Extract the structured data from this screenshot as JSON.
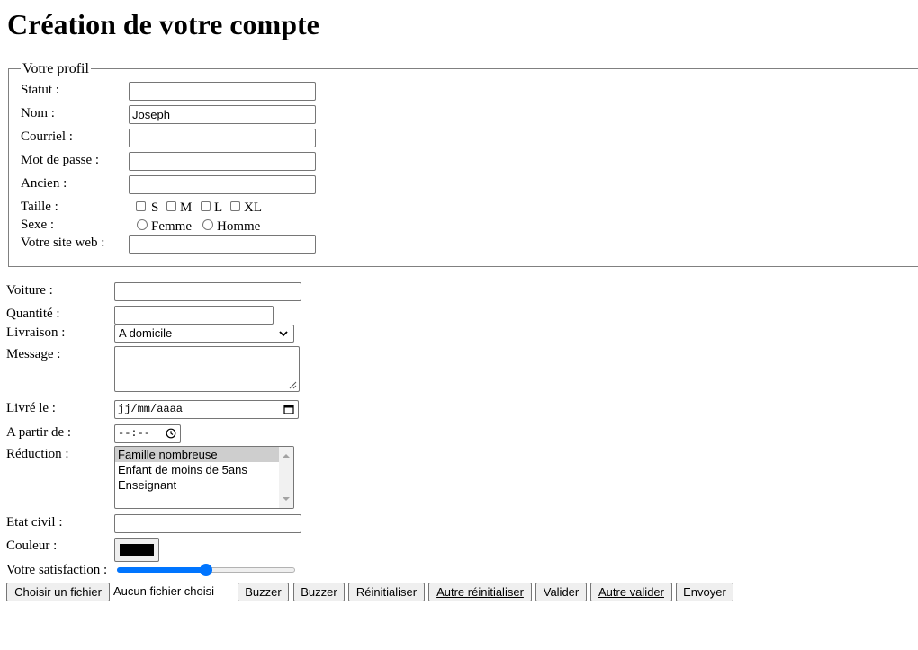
{
  "page_title": "Création de votre compte",
  "fieldset": {
    "legend": "Votre profil",
    "statut": {
      "label": "Statut :",
      "value": ""
    },
    "nom": {
      "label": "Nom :",
      "value": "Joseph"
    },
    "courriel": {
      "label": "Courriel :",
      "value": ""
    },
    "mot_de_passe": {
      "label": "Mot de passe :",
      "value": ""
    },
    "ancien": {
      "label": "Ancien :",
      "value": ""
    },
    "taille": {
      "label": "Taille :",
      "options": [
        "S",
        "M",
        "L",
        "XL"
      ]
    },
    "sexe": {
      "label": "Sexe :",
      "options": [
        "Femme",
        "Homme"
      ]
    },
    "site_web": {
      "label": "Votre site web :",
      "value": ""
    }
  },
  "voiture": {
    "label": "Voiture :",
    "value": ""
  },
  "quantite": {
    "label": "Quantité :",
    "value": ""
  },
  "livraison": {
    "label": "Livraison :",
    "selected": "A domicile"
  },
  "message": {
    "label": "Message :",
    "value": ""
  },
  "livre_le": {
    "label": "Livré le :",
    "placeholder": "jj/mm/aaaa"
  },
  "a_partir_de": {
    "label": "A partir de :",
    "placeholder": "--:--"
  },
  "reduction": {
    "label": "Réduction :",
    "options": [
      "Famille nombreuse",
      "Enfant de moins de 5ans",
      "Enseignant"
    ],
    "selected": "Famille nombreuse"
  },
  "etat_civil": {
    "label": "Etat civil :",
    "value": ""
  },
  "couleur": {
    "label": "Couleur :",
    "value": "#000000"
  },
  "satisfaction": {
    "label": "Votre satisfaction :",
    "value_fraction": 0.5
  },
  "file": {
    "button": "Choisir un fichier",
    "status": "Aucun fichier choisi"
  },
  "buttons": [
    "Buzzer",
    "Buzzer",
    "Réinitialiser",
    "Autre réinitialiser",
    "Valider",
    "Autre valider",
    "Envoyer"
  ]
}
